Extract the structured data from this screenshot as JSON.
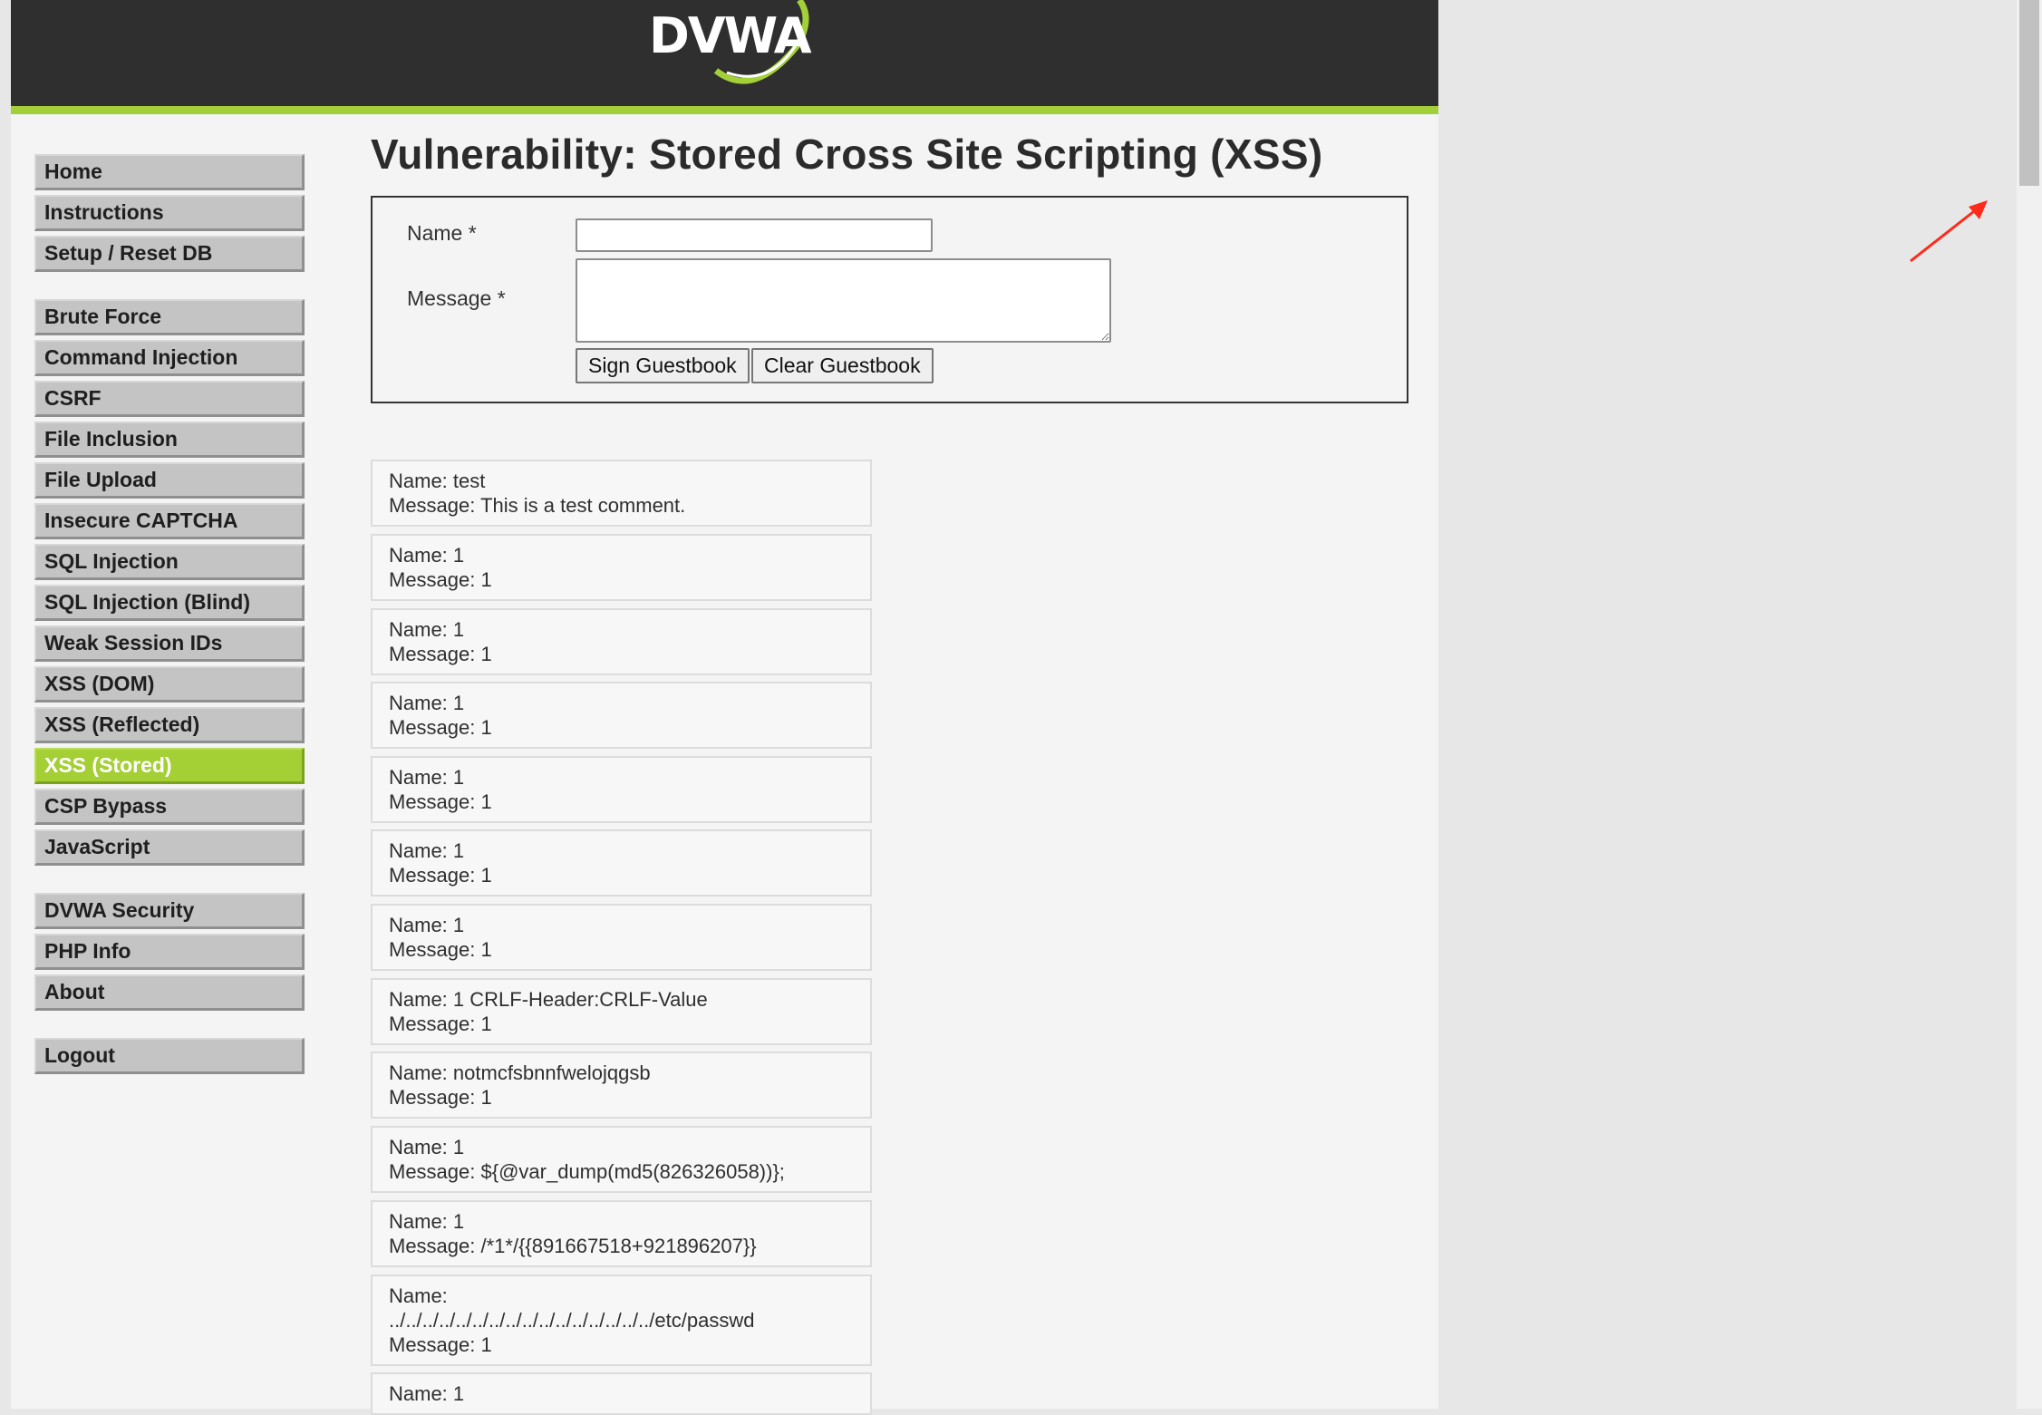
{
  "header": {
    "logo_text": "DVWA",
    "accent_color": "#a3cf38",
    "bg_color": "#2f2f2f"
  },
  "sidebar": {
    "groups": [
      [
        {
          "label": "Home"
        },
        {
          "label": "Instructions"
        },
        {
          "label": "Setup / Reset DB"
        }
      ],
      [
        {
          "label": "Brute Force"
        },
        {
          "label": "Command Injection"
        },
        {
          "label": "CSRF"
        },
        {
          "label": "File Inclusion"
        },
        {
          "label": "File Upload"
        },
        {
          "label": "Insecure CAPTCHA"
        },
        {
          "label": "SQL Injection"
        },
        {
          "label": "SQL Injection (Blind)"
        },
        {
          "label": "Weak Session IDs"
        },
        {
          "label": "XSS (DOM)"
        },
        {
          "label": "XSS (Reflected)"
        },
        {
          "label": "XSS (Stored)",
          "selected": true
        },
        {
          "label": "CSP Bypass"
        },
        {
          "label": "JavaScript"
        }
      ],
      [
        {
          "label": "DVWA Security"
        },
        {
          "label": "PHP Info"
        },
        {
          "label": "About"
        }
      ],
      [
        {
          "label": "Logout"
        }
      ]
    ],
    "selected_color": "#a4cf35"
  },
  "main": {
    "title": "Vulnerability: Stored Cross Site Scripting (XSS)",
    "form": {
      "name_label": "Name *",
      "name_value": "",
      "message_label": "Message *",
      "message_value": "",
      "sign_button": "Sign Guestbook",
      "clear_button": "Clear Guestbook"
    },
    "comments": [
      {
        "name": "Name: test",
        "message": "Message: This is a test comment."
      },
      {
        "name": "Name: 1",
        "message": "Message: 1"
      },
      {
        "name": "Name: 1",
        "message": "Message: 1"
      },
      {
        "name": "Name: 1",
        "message": "Message: 1"
      },
      {
        "name": "Name: 1",
        "message": "Message: 1"
      },
      {
        "name": "Name: 1",
        "message": "Message: 1"
      },
      {
        "name": "Name: 1",
        "message": "Message: 1"
      },
      {
        "name": "Name: 1 CRLF-Header:CRLF-Value",
        "message": "Message: 1"
      },
      {
        "name": "Name: notmcfsbnnfwelojqgsb",
        "message": "Message: 1"
      },
      {
        "name": "Name: 1",
        "message": "Message: ${@var_dump(md5(826326058))};"
      },
      {
        "name": "Name: 1",
        "message": "Message: /*1*/{{891667518+921896207}}"
      },
      {
        "name": "Name:",
        "name_cont": "../../../../../../../../../../../../../../../../etc/passwd",
        "message": "Message: 1"
      },
      {
        "name": "Name: 1",
        "message": ""
      }
    ]
  },
  "annotation": {
    "icon": "red-arrow-icon",
    "color": "#ff2a1a"
  }
}
